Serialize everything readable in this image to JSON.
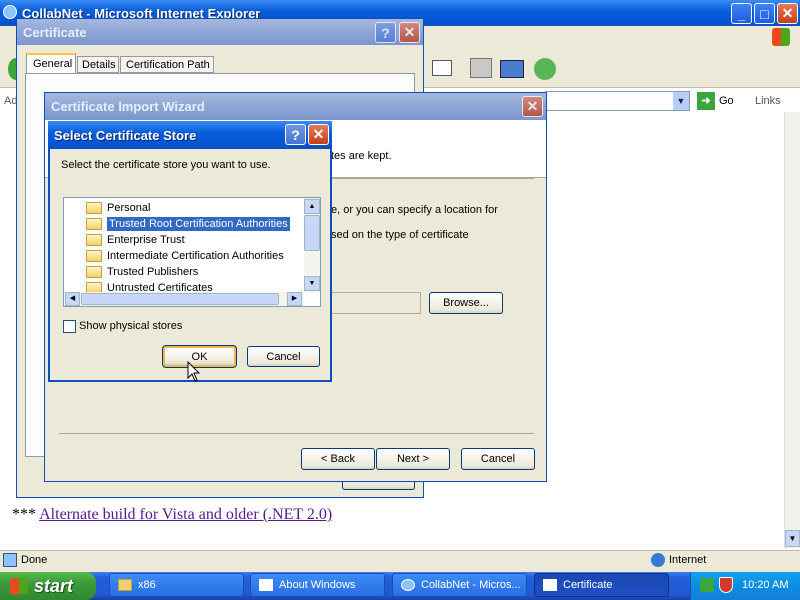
{
  "ie": {
    "title": "CollabNet - Microsoft Internet Explorer",
    "address_label": "Ad",
    "go_label": "Go",
    "links_label": "Links",
    "page_link_prefix": "*** ",
    "page_link": "Alternate build for Vista and older (.NET 2.0)",
    "status_done": "Done",
    "status_zone": "Internet"
  },
  "certificate": {
    "title": "Certificate",
    "tabs": [
      "General",
      "Details",
      "Certification Path"
    ]
  },
  "wizard": {
    "title": "Certificate Import Wizard",
    "text1": "tes are kept.",
    "text2": "e, or you can specify a location for",
    "text3": "sed on the type of certificate",
    "browse": "Browse...",
    "back": "< Back",
    "next": "Next >",
    "cancel": "Cancel"
  },
  "store": {
    "title": "Select Certificate Store",
    "prompt": "Select the certificate store you want to use.",
    "items": [
      "Personal",
      "Trusted Root Certification Authorities",
      "Enterprise Trust",
      "Intermediate Certification Authorities",
      "Trusted Publishers",
      "Untrusted Certificates"
    ],
    "selected_index": 1,
    "show_physical": "Show physical stores",
    "ok": "OK",
    "cancel": "Cancel"
  },
  "taskbar": {
    "start": "start",
    "buttons": [
      "x86",
      "About Windows",
      "CollabNet - Micros...",
      "Certificate"
    ],
    "active_index": 3,
    "clock": "10:20 AM"
  },
  "colors": {
    "title_blue": "#0a5fd8",
    "taskbar_blue": "#245edb",
    "start_green": "#3c9a3c",
    "selection": "#316ac5"
  }
}
